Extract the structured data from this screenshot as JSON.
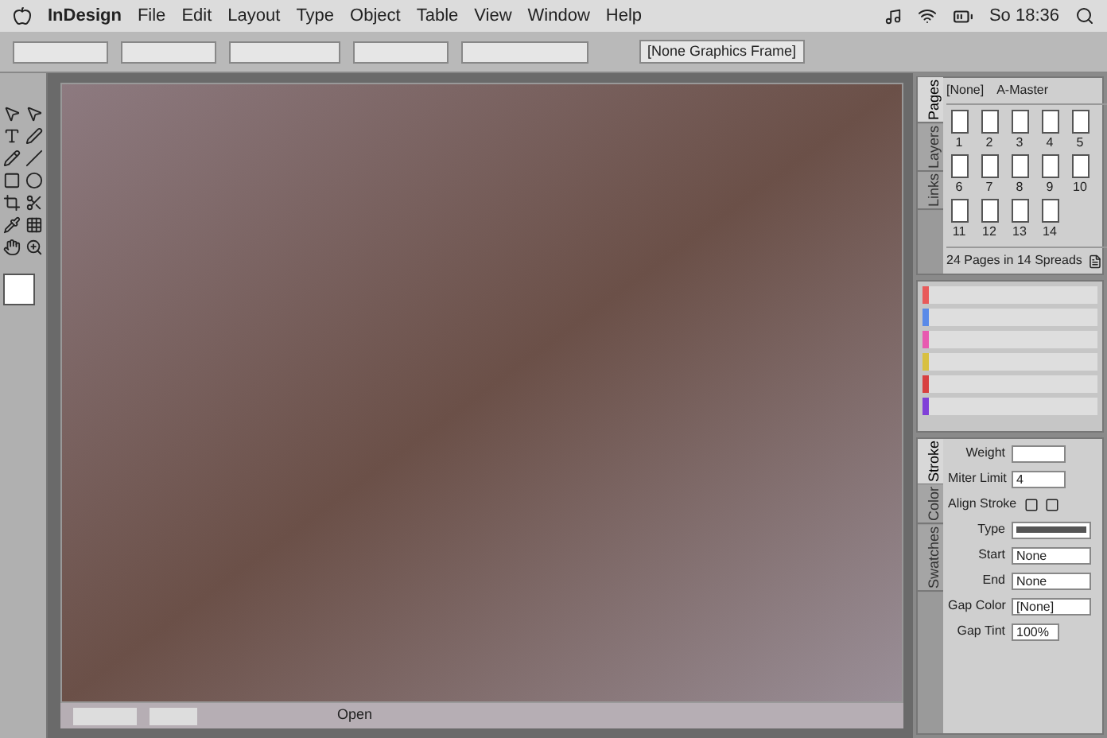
{
  "menu_bar": {
    "app_menu": "InDesign",
    "items": [
      "File",
      "Edit",
      "Layout",
      "Type",
      "Object",
      "Table",
      "View",
      "Window",
      "Help"
    ],
    "clock": "So 18:36"
  },
  "control_bar": {
    "frame_style": "[None Graphics Frame]"
  },
  "pages_panel": {
    "tabs": [
      {
        "label": "Pages",
        "selected": true
      },
      {
        "label": "Layers",
        "selected": false
      },
      {
        "label": "Links",
        "selected": false
      }
    ],
    "masters": [
      "[None]",
      "A-Master"
    ],
    "pages": [
      "1",
      "2",
      "3",
      "4",
      "5",
      "6",
      "7",
      "8",
      "9",
      "10",
      "11",
      "12",
      "13",
      "14"
    ],
    "summary": "24 Pages in 14 Spreads"
  },
  "stroke_panel": {
    "tabs": [
      {
        "label": "Stroke",
        "selected": true
      },
      {
        "label": "Color",
        "selected": false
      },
      {
        "label": "Swatches",
        "selected": false
      }
    ],
    "weight_label": "Weight",
    "miter_label": "Miter Limit",
    "miter_value": "4",
    "align_label": "Align Stroke",
    "fields": [
      {
        "label": "Type",
        "kind": "line"
      },
      {
        "label": "Start",
        "value": "None",
        "kind": "select"
      },
      {
        "label": "End",
        "value": "None",
        "kind": "select"
      },
      {
        "label": "Gap Color",
        "value": "[None]",
        "kind": "swatch"
      },
      {
        "label": "Gap Tint",
        "value": "100%",
        "kind": "text"
      }
    ]
  },
  "status_bar": {
    "status": "Open"
  }
}
